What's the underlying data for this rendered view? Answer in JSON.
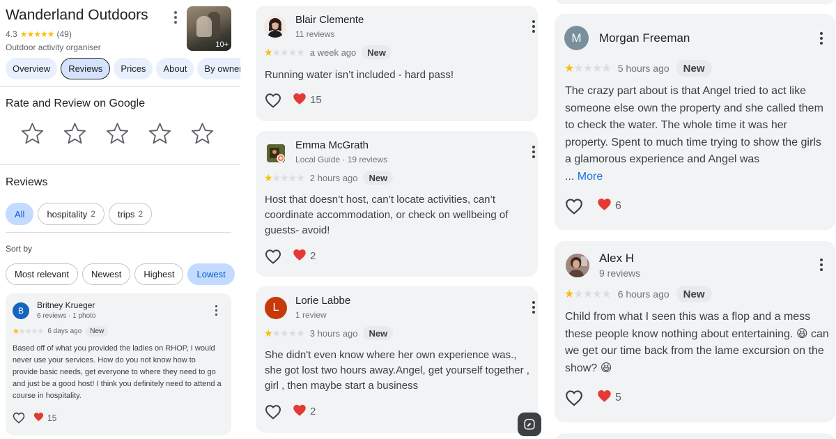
{
  "business": {
    "name": "Wanderland Outdoors",
    "rating": "4.3",
    "review_count": "(49)",
    "category": "Outdoor activity organiser",
    "photo_count": "10+"
  },
  "tabs": [
    {
      "label": "Overview"
    },
    {
      "label": "Reviews"
    },
    {
      "label": "Prices"
    },
    {
      "label": "About"
    },
    {
      "label": "By owner"
    }
  ],
  "rate_section": {
    "title": "Rate and Review on Google"
  },
  "reviews_section": {
    "title": "Reviews",
    "filters": [
      {
        "label": "All",
        "count": ""
      },
      {
        "label": "hospitality",
        "count": "2"
      },
      {
        "label": "trips",
        "count": "2"
      }
    ],
    "sort_label": "Sort by",
    "sort_options": [
      {
        "label": "Most relevant"
      },
      {
        "label": "Newest"
      },
      {
        "label": "Highest"
      },
      {
        "label": "Lowest"
      }
    ]
  },
  "reviews": [
    {
      "author": "Britney Krueger",
      "meta": "6 reviews · 1 photo",
      "avatar_letter": "B",
      "avatar_color": "#1565c0",
      "stars": 1,
      "time": "6 days ago",
      "badge": "New",
      "text": "Based off of what you provided the ladies on RHOP, I would never use your services. How do you not know how to provide basic needs, get everyone to where they need to go and just be a good host! I think you definitely need to attend a course in hospitality.",
      "hearts": "15"
    },
    {
      "author": "Blair Clemente",
      "meta": "11 reviews",
      "stars": 1,
      "time": "a week ago",
      "badge": "New",
      "text": "Running water isn’t included - hard pass!",
      "hearts": "15"
    },
    {
      "author": "Emma McGrath",
      "meta": "Local Guide · 19 reviews",
      "stars": 1,
      "time": "2 hours ago",
      "badge": "New",
      "text": "Host that doesn’t host, can’t locate activities, can’t coordinate accommodation, or check on wellbeing of guests- avoid!",
      "hearts": "2"
    },
    {
      "author": "Lorie Labbe",
      "meta": "1 review",
      "avatar_letter": "L",
      "avatar_color": "#c5390b",
      "stars": 1,
      "time": "3 hours ago",
      "badge": "New",
      "text": "She didn't even know where her own experience was., she got lost two hours away.Angel, get yourself together , girl , then maybe start a business",
      "hearts": "2"
    },
    {
      "author": "Morgan Freeman",
      "meta": "",
      "avatar_letter": "M",
      "avatar_color": "#78909c",
      "stars": 1,
      "time": "5 hours ago",
      "badge": "New",
      "text": "The crazy part about is that Angel tried to act like someone else own the property and she called them to check the water. The whole time it was her property. Spent to much time trying to show the girls a glamorous experience and Angel was",
      "more_prefix": "...",
      "more_label": "More",
      "hearts": "6"
    },
    {
      "author": "Alex H",
      "meta": "9 reviews",
      "stars": 1,
      "time": "6 hours ago",
      "badge": "New",
      "text_part1": "Child from what I seen this was a flop and a mess these people know nothing about entertaining.",
      "emoji": "😆",
      "text_part2": "can we get our time back from the lame excursion on the show?",
      "hearts": "5"
    }
  ],
  "colors": {
    "star": "#fbbc04",
    "accent": "#1a73e8",
    "chip_selected": "#c2dbff",
    "card_bg": "#f1f3f4",
    "heart": "#e53935"
  }
}
